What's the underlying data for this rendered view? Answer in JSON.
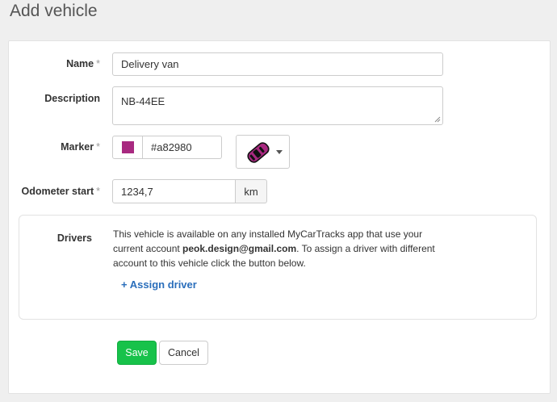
{
  "page": {
    "title": "Add vehicle"
  },
  "form": {
    "name": {
      "label": "Name",
      "required_mark": "*",
      "value": "Delivery van"
    },
    "description": {
      "label": "Description",
      "value": "NB-44EE"
    },
    "marker": {
      "label": "Marker",
      "required_mark": "*",
      "color_value": "#a82980",
      "swatch_color": "#a82980",
      "icon": "car-top-view-icon"
    },
    "odometer": {
      "label": "Odometer start",
      "required_mark": "*",
      "value": "1234,7",
      "unit": "km"
    }
  },
  "drivers": {
    "label": "Drivers",
    "text_before": "This vehicle is available on any installed MyCarTracks app that use your current account ",
    "email": "peok.design@gmail.com",
    "text_after": ". To assign a driver with different account to this vehicle click the button below.",
    "assign_icon": "+",
    "assign_label": "Assign driver"
  },
  "actions": {
    "save_label": "Save",
    "cancel_label": "Cancel"
  },
  "colors": {
    "accent_green": "#17c24a",
    "link_blue": "#2a6ebb",
    "marker": "#a82980"
  }
}
